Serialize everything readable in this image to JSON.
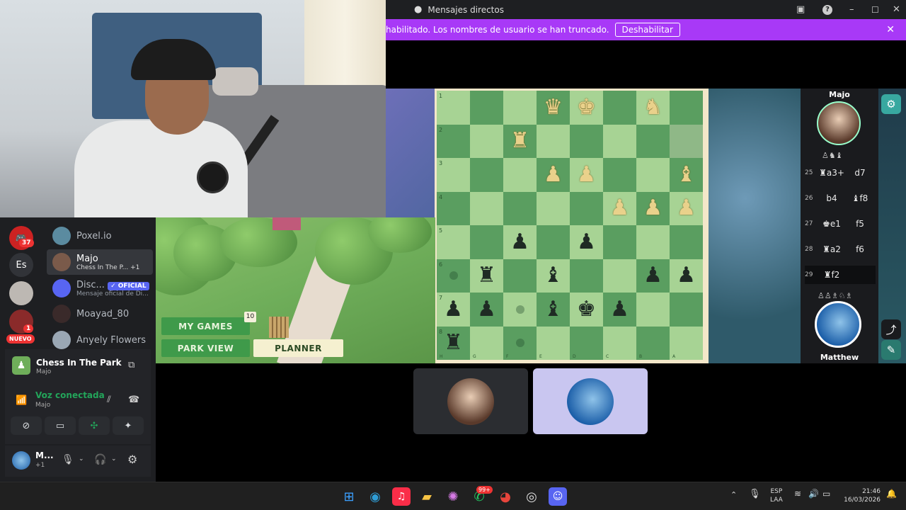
{
  "window": {
    "title": "Mensajes directos"
  },
  "notice": {
    "text": "habilitado. Los nombres de usuario se han truncado.",
    "button": "Deshabilitar"
  },
  "servers": {
    "badge_count": "37",
    "es_label": "Es",
    "nuevo_badge": "NUEVO",
    "nuevo_count": "1"
  },
  "dms": [
    {
      "name": "Poxel.io",
      "sub": ""
    },
    {
      "name": "Majo",
      "sub": "Chess In The P...",
      "extra": "+1"
    },
    {
      "name": "Disc...",
      "sub": "Mensaje oficial de Di...",
      "tag": "✓ OFICIAL"
    },
    {
      "name": "Moayad_80",
      "sub": ""
    },
    {
      "name": "Anyely Flowers",
      "sub": ""
    }
  ],
  "activity": {
    "title": "Chess In The Park",
    "sub": "Majo"
  },
  "voice": {
    "status": "Voz conectada",
    "channel": "Majo"
  },
  "user": {
    "name": "M...",
    "sub": "+1"
  },
  "game": {
    "my_games": "MY GAMES",
    "my_games_count": "10",
    "park_view": "PARK VIEW",
    "planner": "PLANNER"
  },
  "players": {
    "top": "Majo",
    "bottom": "Matthew"
  },
  "board": {
    "rows": [
      "1",
      "2",
      "3",
      "4",
      "5",
      "6",
      "7",
      "8"
    ],
    "cols": [
      "H",
      "G",
      "F",
      "E",
      "D",
      "C",
      "B",
      "A"
    ],
    "pieces": [
      {
        "r": 0,
        "c": 3,
        "p": "♛",
        "side": "w"
      },
      {
        "r": 0,
        "c": 4,
        "p": "♚",
        "side": "w"
      },
      {
        "r": 0,
        "c": 6,
        "p": "♞",
        "side": "w"
      },
      {
        "r": 1,
        "c": 2,
        "p": "♜",
        "side": "w"
      },
      {
        "r": 2,
        "c": 3,
        "p": "♟",
        "side": "w"
      },
      {
        "r": 2,
        "c": 4,
        "p": "♟",
        "side": "w"
      },
      {
        "r": 2,
        "c": 7,
        "p": "♝",
        "side": "w"
      },
      {
        "r": 3,
        "c": 5,
        "p": "♟",
        "side": "w"
      },
      {
        "r": 3,
        "c": 6,
        "p": "♟",
        "side": "w"
      },
      {
        "r": 3,
        "c": 7,
        "p": "♟",
        "side": "w"
      },
      {
        "r": 4,
        "c": 2,
        "p": "♟",
        "side": "b"
      },
      {
        "r": 4,
        "c": 4,
        "p": "♟",
        "side": "b"
      },
      {
        "r": 5,
        "c": 1,
        "p": "♜",
        "side": "b"
      },
      {
        "r": 5,
        "c": 3,
        "p": "♝",
        "side": "b"
      },
      {
        "r": 5,
        "c": 6,
        "p": "♟",
        "side": "b"
      },
      {
        "r": 5,
        "c": 7,
        "p": "♟",
        "side": "b"
      },
      {
        "r": 6,
        "c": 0,
        "p": "♟",
        "side": "b"
      },
      {
        "r": 6,
        "c": 1,
        "p": "♟",
        "side": "b"
      },
      {
        "r": 6,
        "c": 3,
        "p": "♝",
        "side": "b"
      },
      {
        "r": 6,
        "c": 4,
        "p": "♚",
        "side": "b"
      },
      {
        "r": 6,
        "c": 5,
        "p": "♟",
        "side": "b"
      },
      {
        "r": 7,
        "c": 0,
        "p": "♜",
        "side": "b"
      }
    ],
    "dots": [
      {
        "r": 5,
        "c": 0
      },
      {
        "r": 6,
        "c": 2
      },
      {
        "r": 7,
        "c": 2
      }
    ]
  },
  "moves": [
    {
      "n": "25",
      "a": "♜a3+",
      "b": "d7"
    },
    {
      "n": "26",
      "a": "b4",
      "b": "♝f8"
    },
    {
      "n": "27",
      "a": "♚e1",
      "b": "f5"
    },
    {
      "n": "28",
      "a": "♜a2",
      "b": "f6"
    },
    {
      "n": "29",
      "a": "♜f2",
      "b": ""
    }
  ],
  "taskbar": {
    "badge_whatsapp": "99+",
    "lang1": "ESP",
    "lang2": "LAA",
    "time": "21:46",
    "date": "16/03/2026"
  }
}
